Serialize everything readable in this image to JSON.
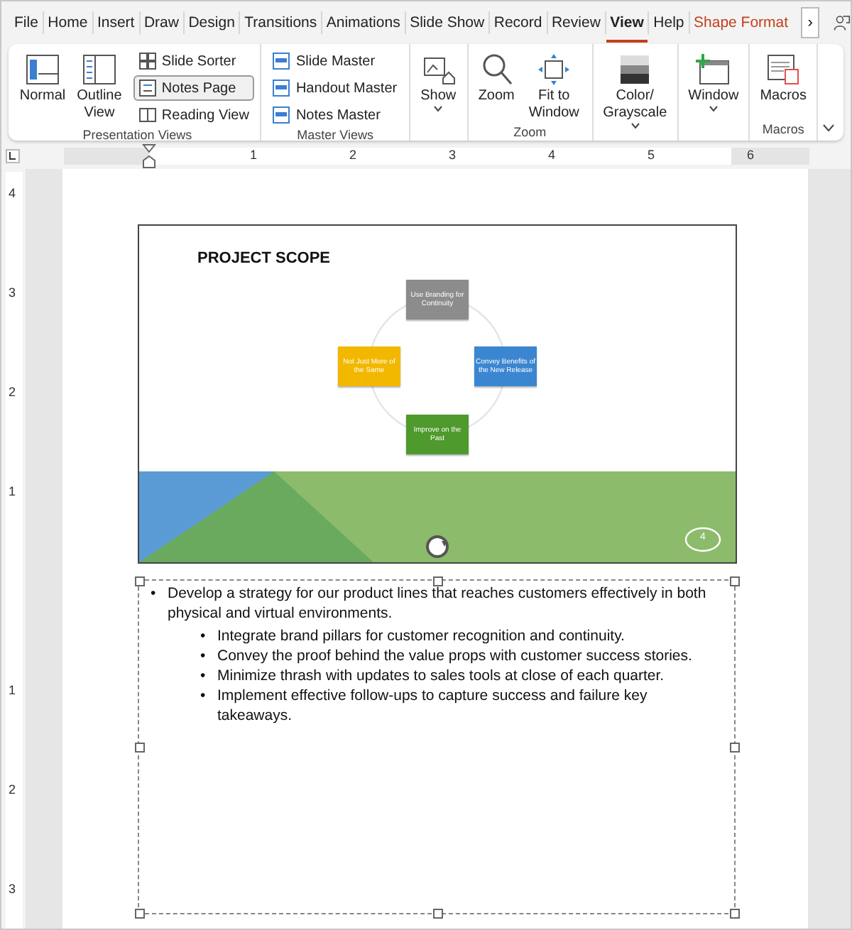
{
  "tabs": [
    {
      "label": "File",
      "selected": false,
      "kind": "normal"
    },
    {
      "label": "Home",
      "selected": false,
      "kind": "normal"
    },
    {
      "label": "Insert",
      "selected": false,
      "kind": "normal"
    },
    {
      "label": "Draw",
      "selected": false,
      "kind": "normal"
    },
    {
      "label": "Design",
      "selected": false,
      "kind": "normal"
    },
    {
      "label": "Transitions",
      "selected": false,
      "kind": "normal"
    },
    {
      "label": "Animations",
      "selected": false,
      "kind": "normal"
    },
    {
      "label": "Slide Show",
      "selected": false,
      "kind": "normal"
    },
    {
      "label": "Record",
      "selected": false,
      "kind": "normal"
    },
    {
      "label": "Review",
      "selected": false,
      "kind": "normal"
    },
    {
      "label": "View",
      "selected": true,
      "kind": "normal"
    },
    {
      "label": "Help",
      "selected": false,
      "kind": "normal"
    },
    {
      "label": "Shape Format",
      "selected": false,
      "kind": "contextual"
    }
  ],
  "tab_overflow": "›",
  "ribbon_groups": [
    {
      "label": "Presentation Views",
      "items": [
        {
          "label": "Normal",
          "kind": "large",
          "selected": false
        },
        {
          "label": "Outline View",
          "kind": "large",
          "selected": false
        },
        {
          "label": "Slide Sorter",
          "kind": "small",
          "selected": false
        },
        {
          "label": "Notes Page",
          "kind": "small",
          "selected": true
        },
        {
          "label": "Reading View",
          "kind": "small",
          "selected": false
        }
      ]
    },
    {
      "label": "Master Views",
      "items": [
        {
          "label": "Slide Master",
          "kind": "small",
          "selected": false
        },
        {
          "label": "Handout Master",
          "kind": "small",
          "selected": false
        },
        {
          "label": "Notes Master",
          "kind": "small",
          "selected": false
        }
      ]
    },
    {
      "items": [
        {
          "label": "Show",
          "kind": "large",
          "selected": false,
          "dropdown": true
        }
      ]
    },
    {
      "label": "Zoom",
      "items": [
        {
          "label": "Zoom",
          "kind": "large",
          "selected": false
        },
        {
          "label": "Fit to Window",
          "kind": "large",
          "selected": false
        }
      ]
    },
    {
      "items": [
        {
          "label": "Color/ Grayscale",
          "kind": "large",
          "selected": false,
          "dropdown": true
        }
      ]
    },
    {
      "items": [
        {
          "label": "Window",
          "kind": "large",
          "selected": false,
          "dropdown": true
        }
      ]
    },
    {
      "label": "Macros",
      "items": [
        {
          "label": "Macros",
          "kind": "large",
          "selected": false
        }
      ]
    }
  ],
  "horizontal_ruler": [
    "1",
    "2",
    "3",
    "4",
    "5",
    "6"
  ],
  "vertical_ruler": {
    "upper": [
      "4",
      "3",
      "2",
      "1"
    ],
    "lower": [
      "1",
      "2",
      "3"
    ]
  },
  "slide": {
    "title": "PROJECT SCOPE",
    "nodes": [
      {
        "text": "Use Branding for Continuity",
        "color": "#8c8c8c"
      },
      {
        "text": "Not Just More of the Same",
        "color": "#f2b800"
      },
      {
        "text": "Convey Benefits of the New Release",
        "color": "#3b86d0"
      },
      {
        "text": "Improve on the Past",
        "color": "#4f9a2c"
      }
    ],
    "slide_number": "4"
  },
  "notes": [
    {
      "bullet": "•",
      "text": "Develop a strategy for our product lines that reaches customers effectively in both physical and virtual environments.",
      "children": [
        {
          "bullet": "•",
          "text": "Integrate brand pillars for customer recognition and continuity."
        },
        {
          "bullet": "•",
          "text": "Convey the proof behind the value props with customer success stories."
        },
        {
          "bullet": "•",
          "text": "Minimize thrash with updates to sales tools at close of each quarter."
        },
        {
          "bullet": "•",
          "text": "Implement effective follow-ups to capture success and failure key takeaways."
        }
      ]
    }
  ]
}
